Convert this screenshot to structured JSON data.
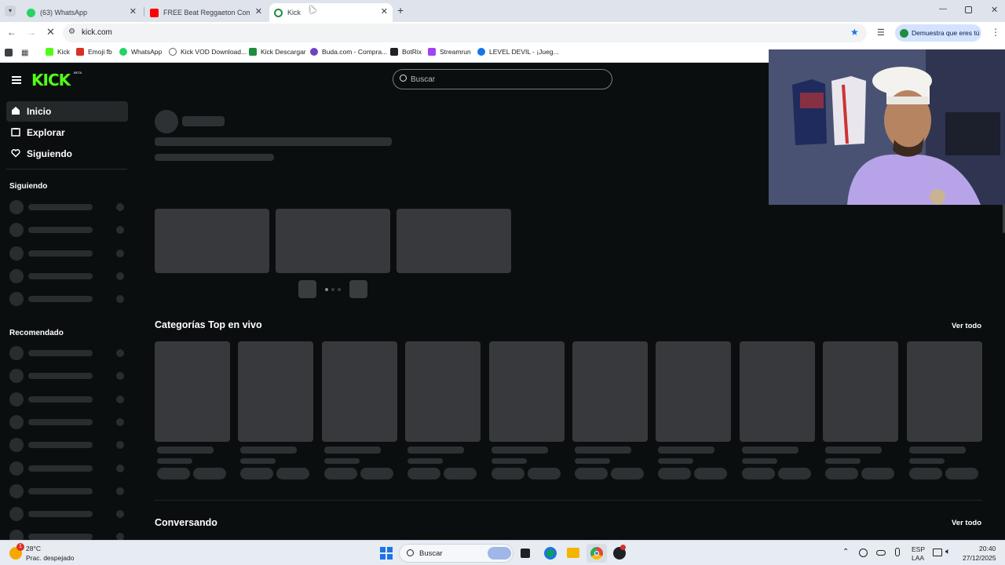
{
  "browser": {
    "tabs": [
      {
        "label": "(63) WhatsApp",
        "favicon_color": "#25d366"
      },
      {
        "label": "FREE Beat Reggaeton Comercia",
        "favicon_color": "#ff0000"
      },
      {
        "label": "Kick",
        "favicon_color": "#53fc18"
      }
    ],
    "url": "kick.com",
    "profile_chip": "Demuestra que eres tú",
    "bookmarks": [
      {
        "label": "Kick",
        "color": "#53fc18"
      },
      {
        "label": "Emoji fb",
        "color": "#d93025"
      },
      {
        "label": "WhatsApp",
        "color": "#25d366"
      },
      {
        "label": "Kick VOD Download...",
        "color": "#5f6368"
      },
      {
        "label": "Kick Descargar",
        "color": "#1e8e3e"
      },
      {
        "label": "Buda.com - Compra...",
        "color": "#6f42c1"
      },
      {
        "label": "BotRix",
        "color": "#202124"
      },
      {
        "label": "Streamrun",
        "color": "#a142f4"
      },
      {
        "label": "LEVEL DEVIL - ¡Jueg...",
        "color": "#1a73e8"
      }
    ]
  },
  "kick": {
    "logo": "KICK",
    "logo_badge": "BETA",
    "search_placeholder": "Buscar",
    "nav": [
      {
        "label": "Inicio",
        "icon": "home-icon"
      },
      {
        "label": "Explorar",
        "icon": "explore-icon"
      },
      {
        "label": "Siguiendo",
        "icon": "heart-icon"
      }
    ],
    "following_heading": "Siguiendo",
    "recommended_heading": "Recomendado",
    "section_top_categories": "Categorías Top en vivo",
    "section_talking": "Conversando",
    "see_all": "Ver todo",
    "accent": "#53fc18"
  },
  "taskbar": {
    "weather_temp": "28°C",
    "weather_desc": "Prac. despejado",
    "weather_badge": "1",
    "search_label": "Buscar",
    "lang_top": "ESP",
    "lang_bottom": "LAA",
    "time": "20:40",
    "date": "27/12/2025"
  }
}
